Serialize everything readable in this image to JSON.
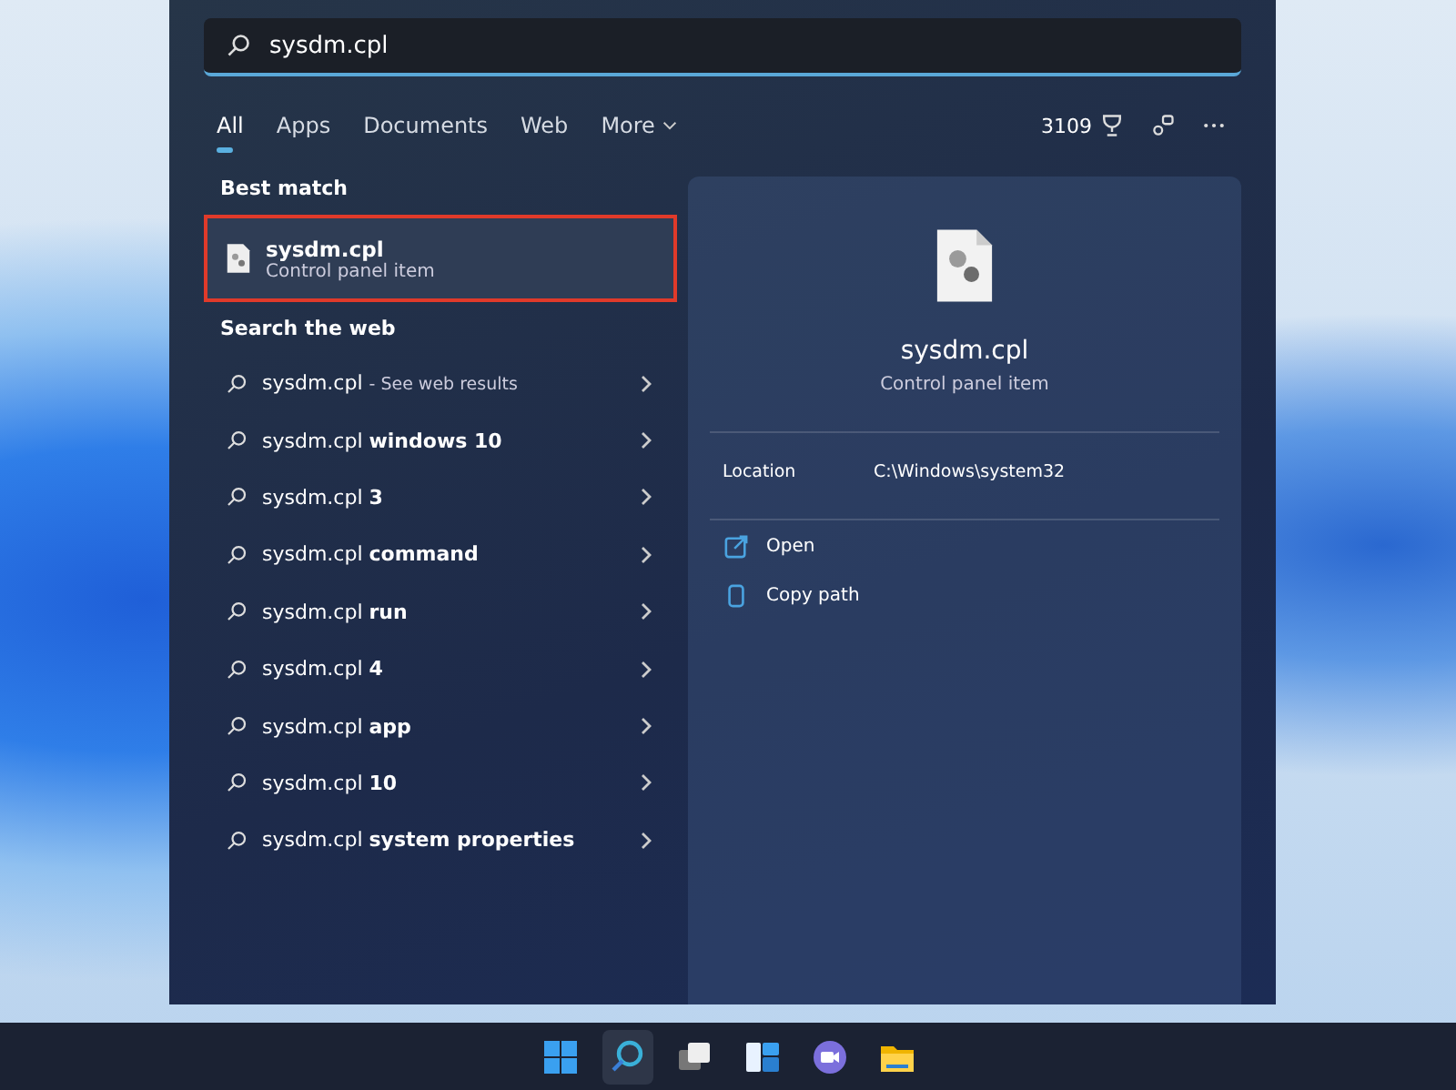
{
  "search": {
    "value": "sysdm.cpl"
  },
  "tabs": [
    {
      "label": "All",
      "selected": true
    },
    {
      "label": "Apps",
      "selected": false
    },
    {
      "label": "Documents",
      "selected": false
    },
    {
      "label": "Web",
      "selected": false
    },
    {
      "label": "More",
      "selected": false,
      "kind": "dropdown"
    }
  ],
  "toolbar": {
    "points": "3109"
  },
  "best_match": {
    "heading": "Best match",
    "title": "sysdm.cpl",
    "subtitle": "Control panel item"
  },
  "web": {
    "heading": "Search the web",
    "results": [
      {
        "query": "sysdm.cpl",
        "suffix": "- See web results",
        "kind": "hint"
      },
      {
        "query": "sysdm.cpl",
        "suffix": "windows 10",
        "kind": "bold"
      },
      {
        "query": "sysdm.cpl",
        "suffix": "3",
        "kind": "bold"
      },
      {
        "query": "sysdm.cpl",
        "suffix": "command",
        "kind": "bold"
      },
      {
        "query": "sysdm.cpl",
        "suffix": "run",
        "kind": "bold"
      },
      {
        "query": "sysdm.cpl",
        "suffix": "4",
        "kind": "bold"
      },
      {
        "query": "sysdm.cpl",
        "suffix": "app",
        "kind": "bold"
      },
      {
        "query": "sysdm.cpl",
        "suffix": "10",
        "kind": "bold"
      },
      {
        "query": "sysdm.cpl",
        "suffix": "system properties",
        "kind": "bold"
      }
    ]
  },
  "details": {
    "title": "sysdm.cpl",
    "subtitle": "Control panel item",
    "location_label": "Location",
    "location": "C:\\Windows\\system32",
    "actions": [
      {
        "label": "Open",
        "kind": "open"
      },
      {
        "label": "Copy path",
        "kind": "copy"
      }
    ]
  },
  "taskbar": [
    {
      "kind": "start",
      "selected": false
    },
    {
      "kind": "search",
      "selected": true
    },
    {
      "kind": "taskview",
      "selected": false
    },
    {
      "kind": "widgets",
      "selected": false
    },
    {
      "kind": "chat",
      "selected": false
    },
    {
      "kind": "explorer",
      "selected": false
    }
  ]
}
